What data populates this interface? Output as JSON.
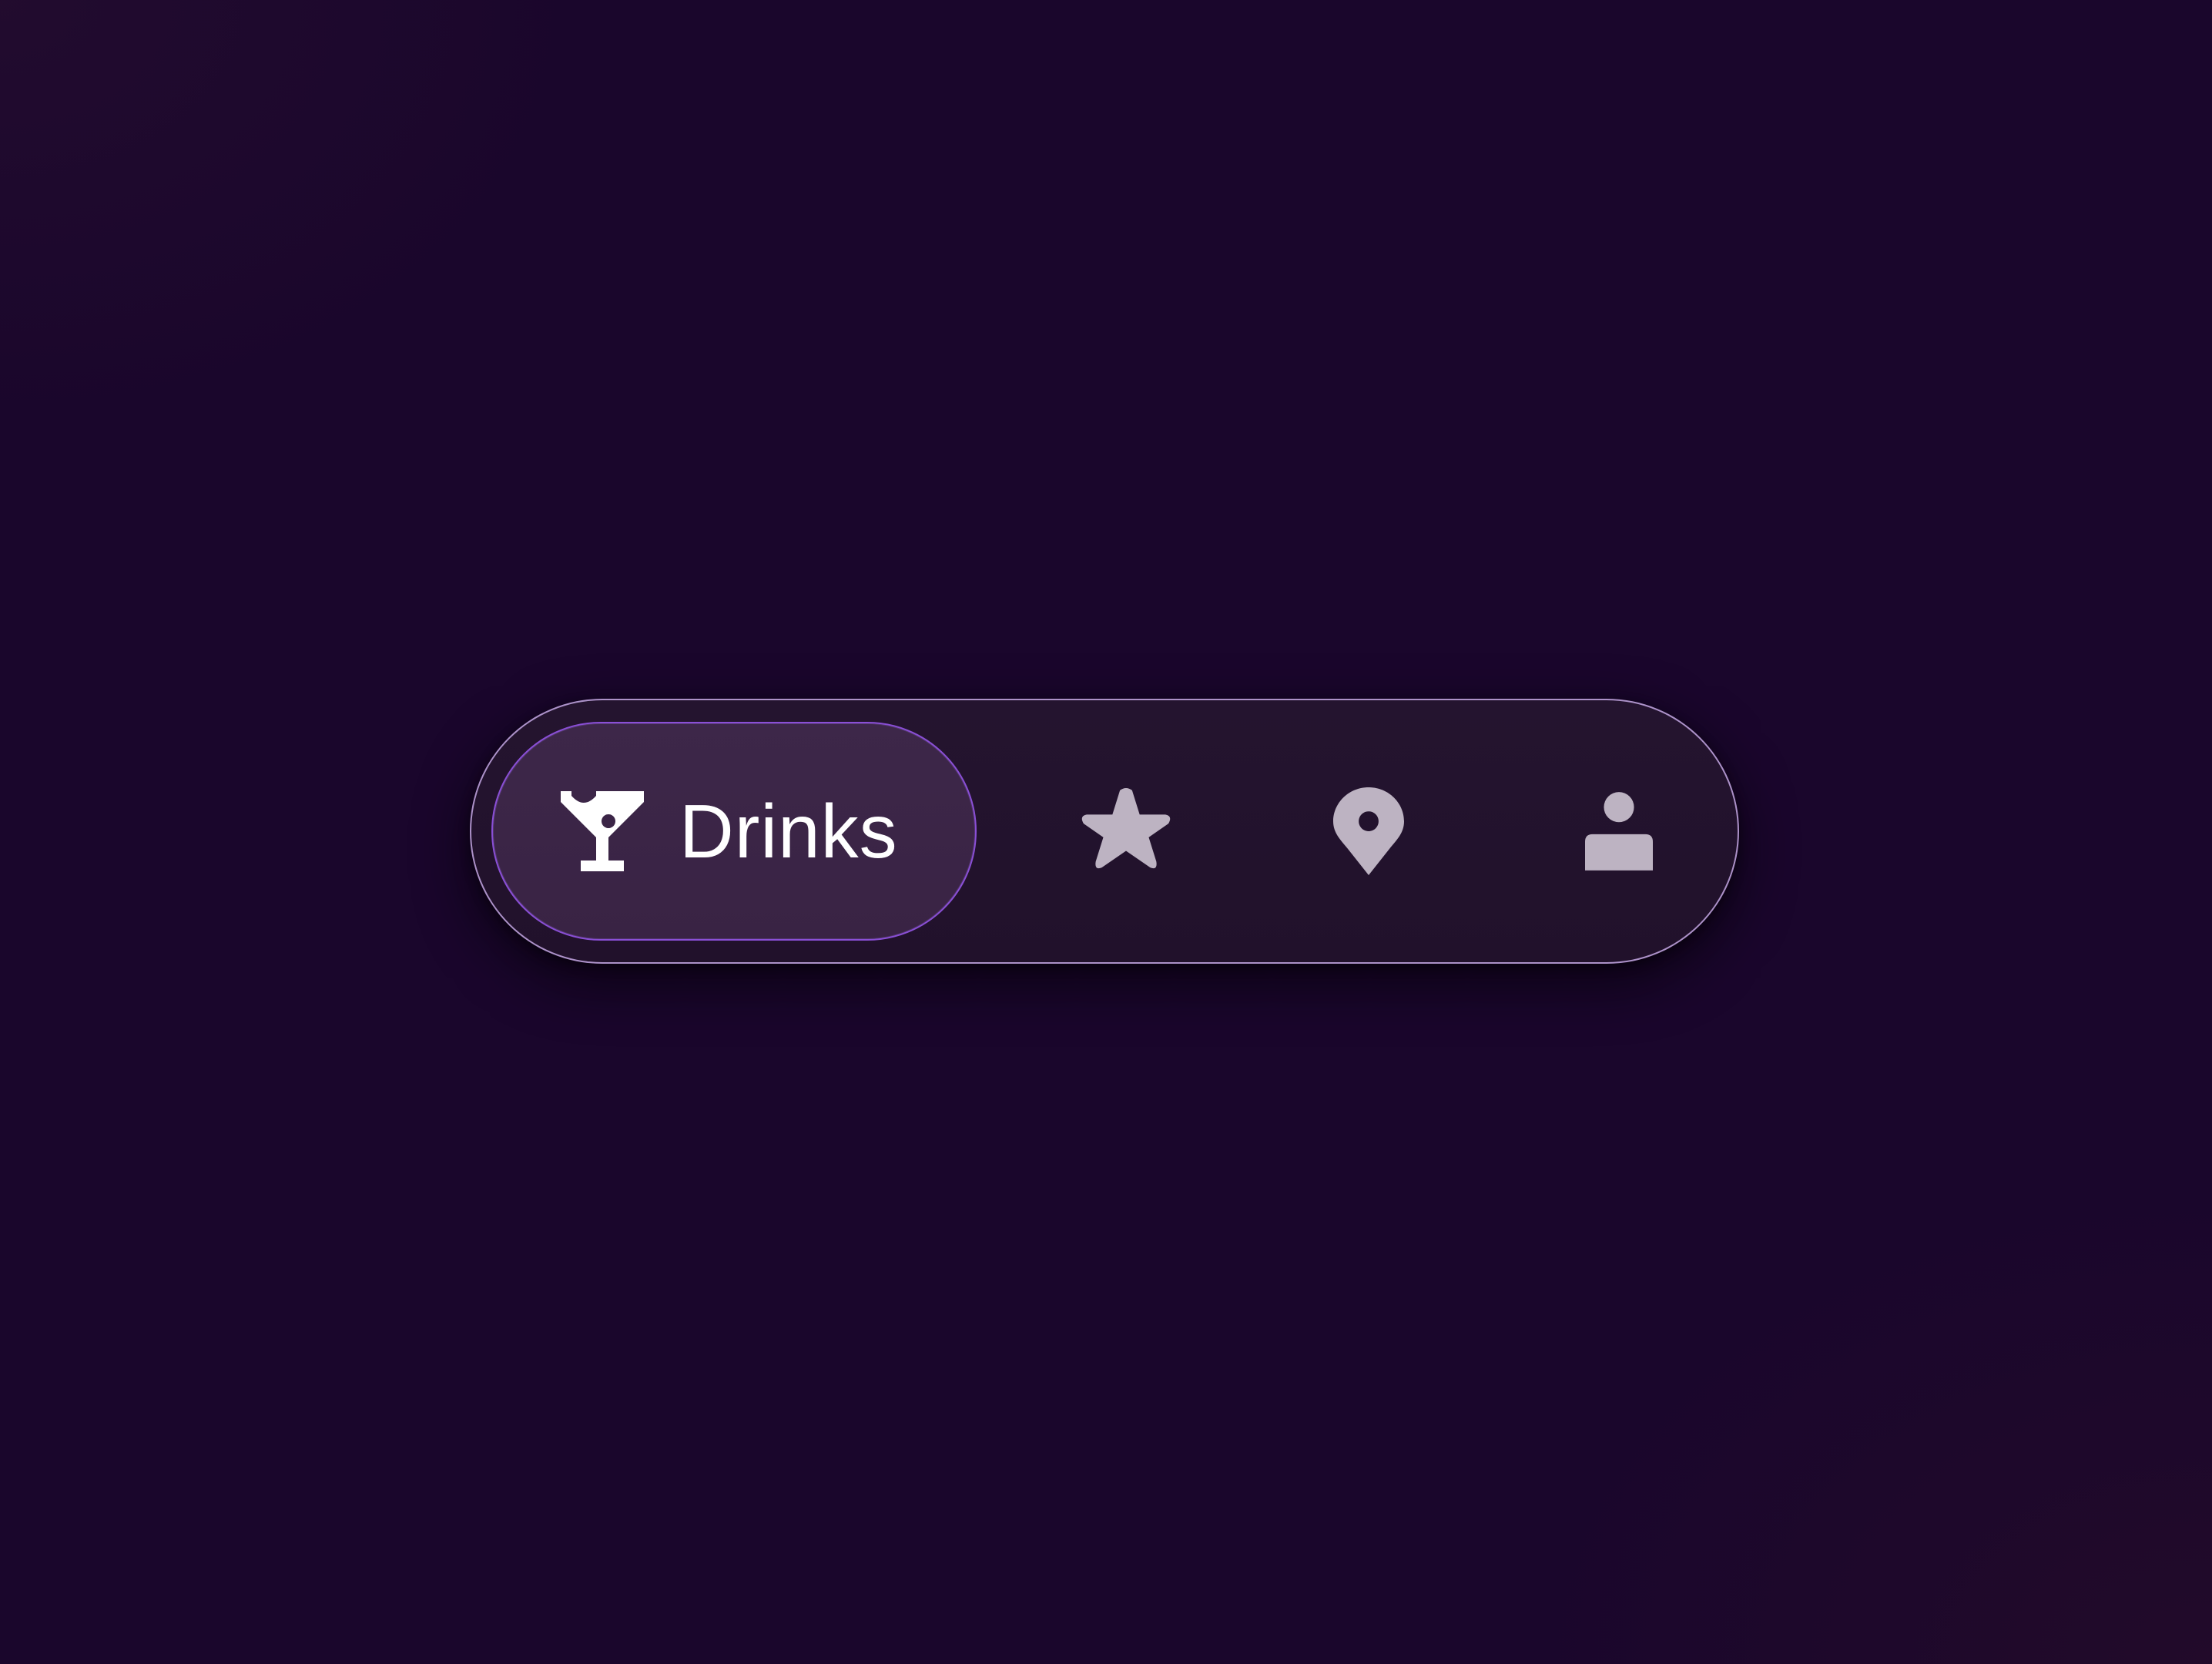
{
  "navigation": {
    "items": [
      {
        "id": "drinks",
        "label": "Drinks",
        "icon": "cocktail-icon",
        "active": true
      },
      {
        "id": "favorites",
        "icon": "star-icon",
        "active": false
      },
      {
        "id": "location",
        "icon": "map-pin-icon",
        "active": false
      },
      {
        "id": "profile",
        "icon": "user-icon",
        "active": false
      }
    ]
  },
  "colors": {
    "background": "#1a062c",
    "bar_background": "#22122d",
    "bar_border": "#c4a8e4",
    "active_background": "#3b2546",
    "active_border": "#8a4fd6",
    "active_text": "#ffffff",
    "inactive_icon": "#bdb3c2"
  }
}
